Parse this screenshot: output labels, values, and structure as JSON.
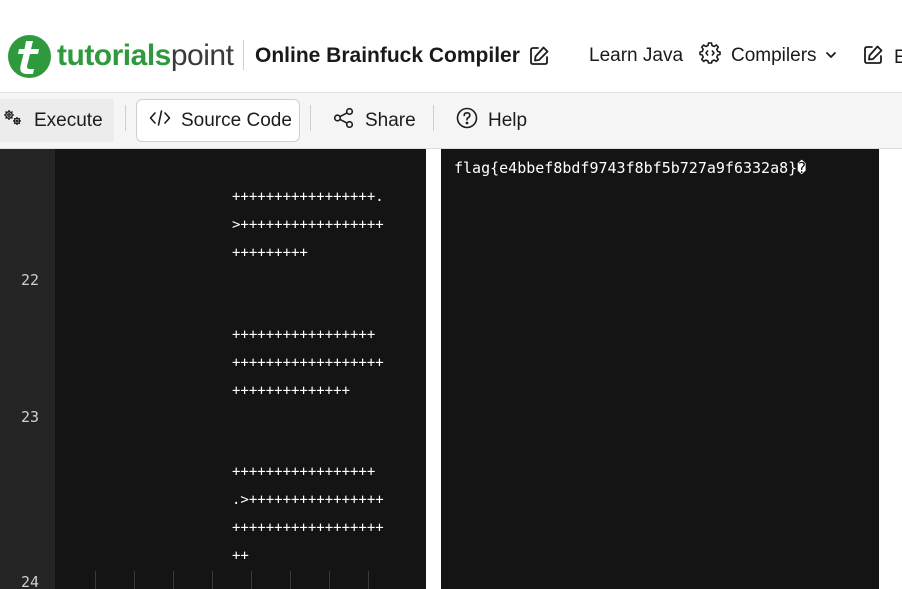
{
  "header": {
    "logo_text_primary": "tutorials",
    "logo_text_secondary": "point",
    "title": "Online Brainfuck Compiler",
    "nav": {
      "learn": "Learn Java",
      "compilers": "Compilers",
      "edit_partial": "E"
    }
  },
  "toolbar": {
    "execute": "Execute",
    "source_code": "Source Code",
    "share": "Share",
    "help": "Help"
  },
  "editor": {
    "line_numbers": [
      "22",
      "23",
      "24"
    ],
    "code_lines": [
      "+++++++++++++++++.",
      ">+++++++++++++++++",
      "+++++++++",
      "+++++++++++++++++",
      "++++++++++++++++++",
      "++++++++++++++",
      "+++++++++++++++++",
      ".>++++++++++++++++",
      "++++++++++++++++++",
      "++"
    ]
  },
  "output": {
    "text": "flag{e4bbef8bdf9743f8bf5b727a9f6332a8}�"
  },
  "colors": {
    "brand_green": "#2e9a3d",
    "editor_bg": "#141414",
    "gutter_bg": "#252526"
  },
  "icons": {
    "logo": "tutorialspoint-logo-icon",
    "title_edit": "edit-icon",
    "compilers": "gear-code-icon",
    "execute": "gears-icon",
    "source": "code-icon",
    "share": "share-icon",
    "help": "help-circle-icon"
  }
}
